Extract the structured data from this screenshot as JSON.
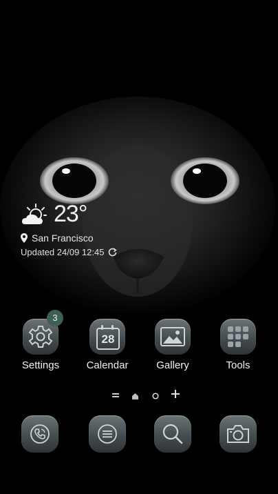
{
  "weather": {
    "temperature": "23°",
    "location": "San Francisco",
    "updated": "Updated 24/09 12:45"
  },
  "apps": [
    {
      "label": "Settings",
      "badge": "3"
    },
    {
      "label": "Calendar",
      "date": "28"
    },
    {
      "label": "Gallery"
    },
    {
      "label": "Tools"
    }
  ],
  "pager": {
    "current_page": 1,
    "pages": 2
  },
  "dock": [
    "phone",
    "menu",
    "search",
    "camera"
  ]
}
